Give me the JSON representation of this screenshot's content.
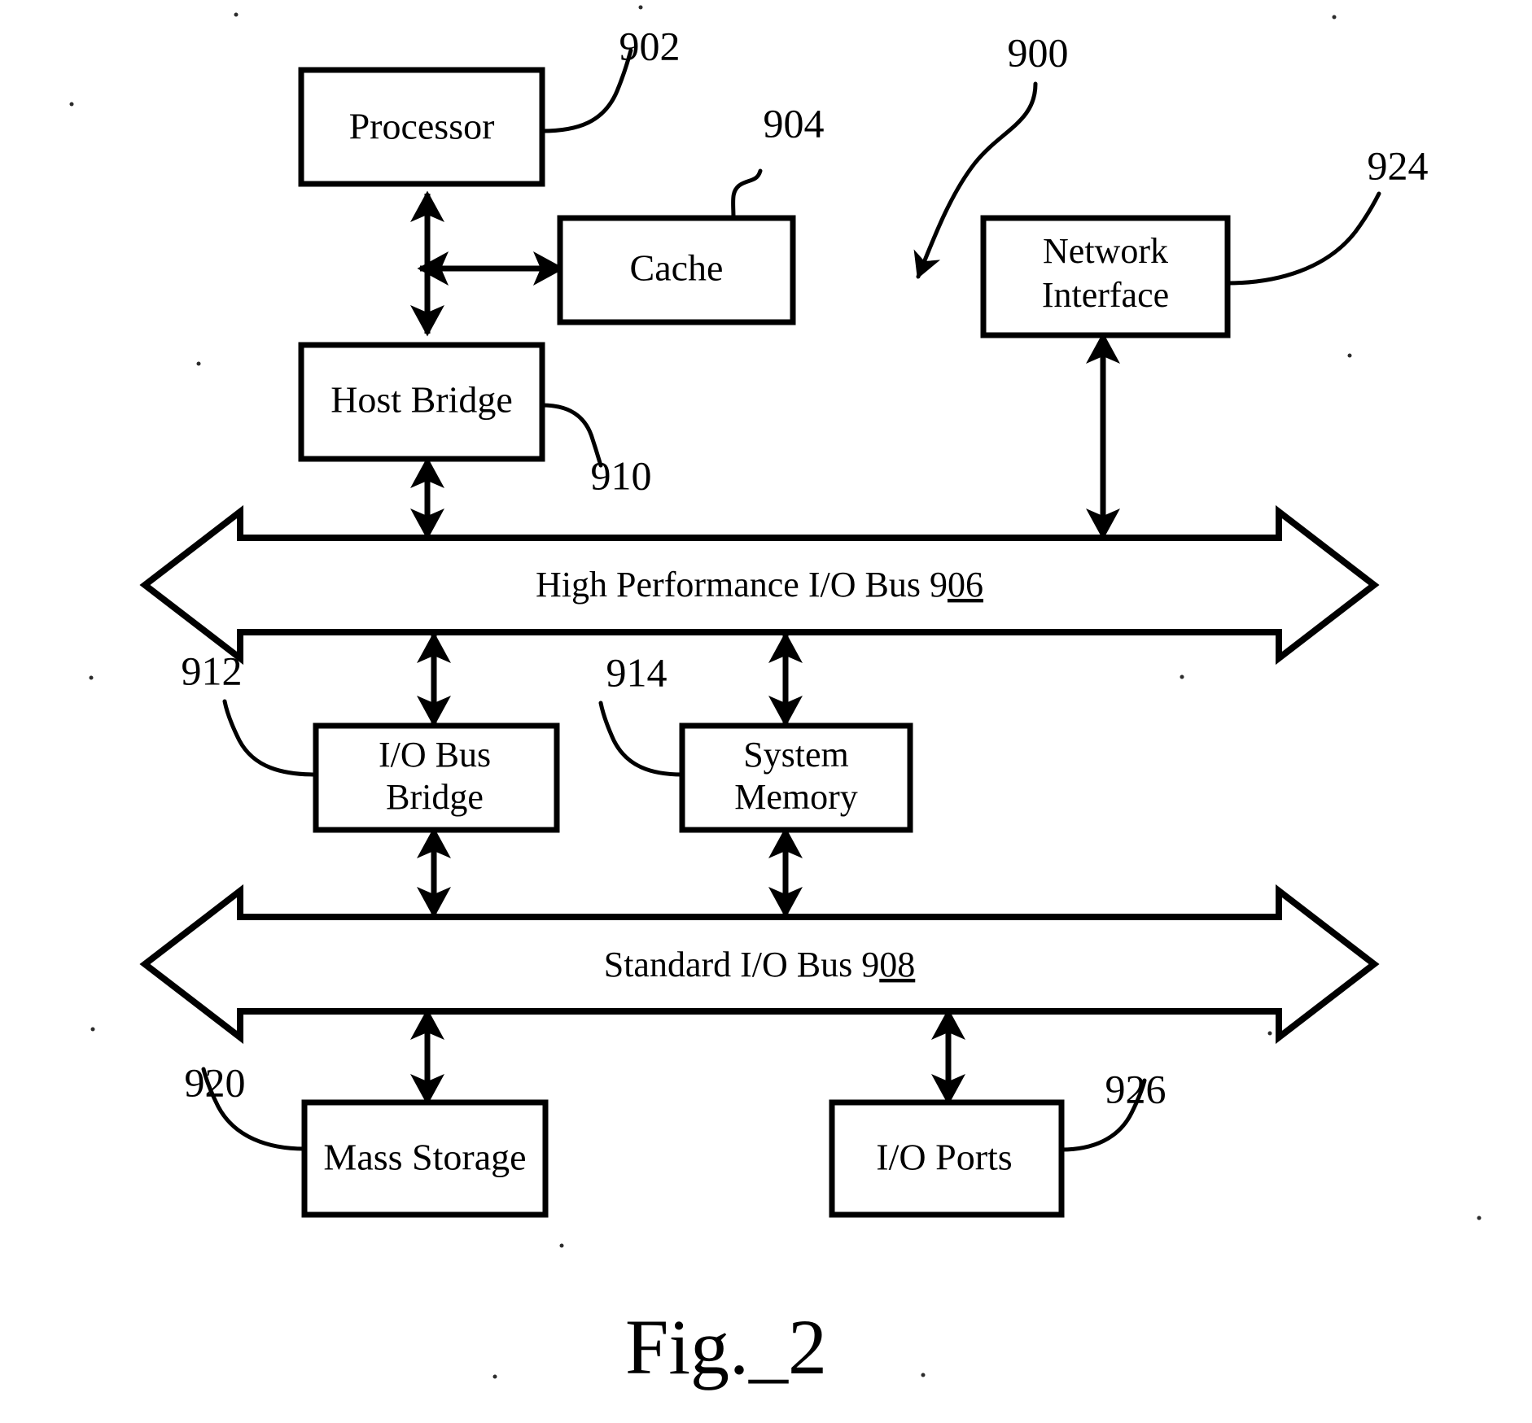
{
  "figure": {
    "caption": "Fig._2",
    "system_ref": "900"
  },
  "boxes": [
    {
      "id": "processor",
      "label": "Processor",
      "ref": "902"
    },
    {
      "id": "cache",
      "label": "Cache",
      "ref": "904"
    },
    {
      "id": "network_interface",
      "label_line1": "Network",
      "label_line2": "Interface",
      "ref": "924"
    },
    {
      "id": "host_bridge",
      "label": "Host Bridge",
      "ref": "910"
    },
    {
      "id": "io_bus_bridge",
      "label_line1": "I/O Bus",
      "label_line2": "Bridge",
      "ref": "912"
    },
    {
      "id": "system_memory",
      "label_line1": "System",
      "label_line2": "Memory",
      "ref": "914"
    },
    {
      "id": "mass_storage",
      "label": "Mass Storage",
      "ref": "920"
    },
    {
      "id": "io_ports",
      "label": "I/O Ports",
      "ref": "926"
    }
  ],
  "buses": [
    {
      "id": "high_performance_io_bus",
      "text_prefix": "High Performance I/O Bus 9",
      "text_underlined": "06"
    },
    {
      "id": "standard_io_bus",
      "text_prefix": "Standard I/O Bus 9",
      "text_underlined": "08"
    }
  ],
  "refs": {
    "processor": "902",
    "cache": "904",
    "system": "900",
    "network_interface": "924",
    "host_bridge": "910",
    "io_bus_bridge": "912",
    "system_memory": "914",
    "mass_storage": "920",
    "io_ports": "926"
  },
  "colors": {
    "ink": "#000000",
    "paper": "#ffffff"
  }
}
